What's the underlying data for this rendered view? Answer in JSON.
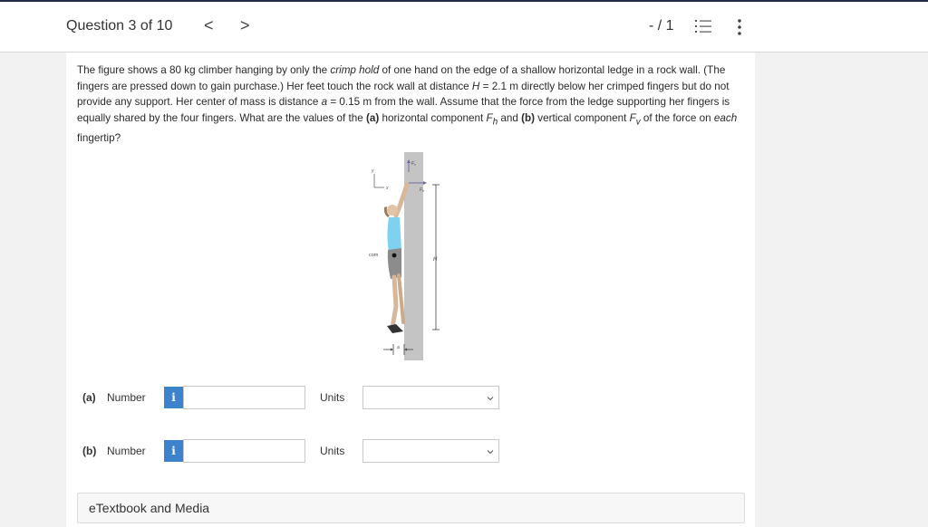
{
  "header": {
    "question_title": "Question 3 of 10",
    "prev_glyph": "<",
    "next_glyph": ">",
    "score": "- / 1",
    "icons": {
      "list": "numbered-list-icon",
      "more": "more-vertical-icon"
    }
  },
  "problem": {
    "p1": "The figure shows a 80 kg climber hanging by only the ",
    "crimp": "crimp hold",
    "p2": " of one hand on the edge of a shallow horizontal ledge in a rock wall. (The fingers are pressed down to gain purchase.) Her feet touch the rock wall at distance ",
    "H": "H",
    "p3": " = 2.1 m directly below her crimped fingers but do not provide any support. Her center of mass is distance ",
    "a": "a",
    "p4": " = 0.15 m from the wall. Assume that the force from the ledge supporting her fingers is equally shared by the four fingers. What are the values of the ",
    "part_a": "(a)",
    "p5": " horizontal component ",
    "Fh": "F",
    "Fh_sub": "h",
    "p6": " and ",
    "part_b": "(b)",
    "p7": " vertical component ",
    "Fv": "F",
    "Fv_sub": "v",
    "p8": " of the force on ",
    "each": "each",
    "p9": " fingertip?"
  },
  "figure": {
    "y_axis": "y",
    "x_axis": "x",
    "fv_label": "Fv",
    "fh_label": "Fh",
    "com_label": "com",
    "h_label": "H",
    "a_label": "a"
  },
  "answers": [
    {
      "part": "(a)",
      "number_label": "Number",
      "info": "i",
      "value": "",
      "units_label": "Units",
      "units_value": ""
    },
    {
      "part": "(b)",
      "number_label": "Number",
      "info": "i",
      "value": "",
      "units_label": "Units",
      "units_value": ""
    }
  ],
  "etextbook": {
    "label": "eTextbook and Media"
  }
}
